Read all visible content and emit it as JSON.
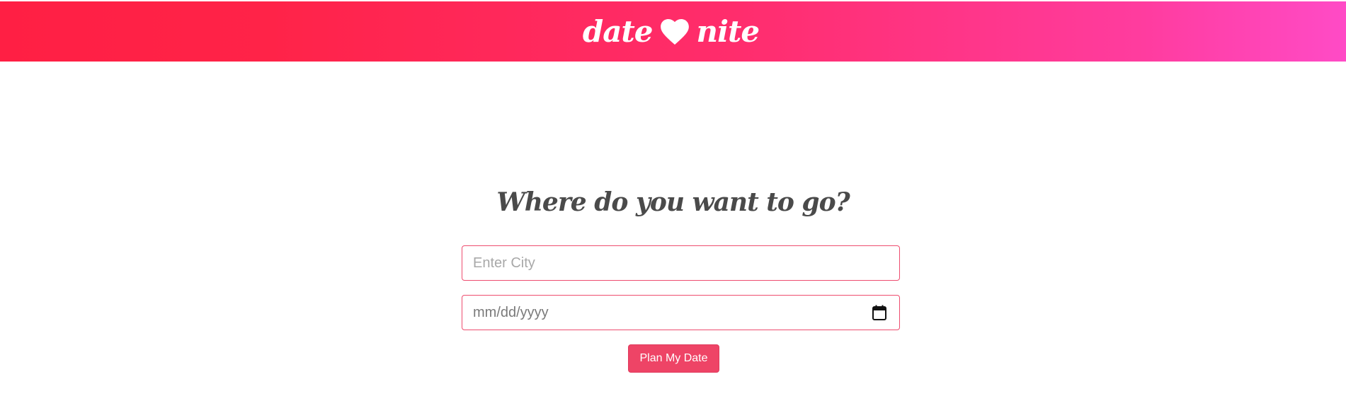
{
  "navbar": {
    "brand_left": "date",
    "brand_icon": "heart-icon",
    "brand_right": "nite",
    "gradient_colors": [
      "#ff1f44",
      "#ff2d6d",
      "#ff4bc6"
    ]
  },
  "main": {
    "heading": "Where do you want to go?",
    "city_input": {
      "placeholder": "Enter City",
      "value": ""
    },
    "date_input": {
      "placeholder": "mm/dd/yyyy",
      "value": "",
      "icon": "calendar-icon"
    },
    "submit_label": "Plan My Date"
  },
  "colors": {
    "accent": "#ee4466",
    "field_border": "#ee4d6f",
    "heading": "#4a4a4a"
  }
}
